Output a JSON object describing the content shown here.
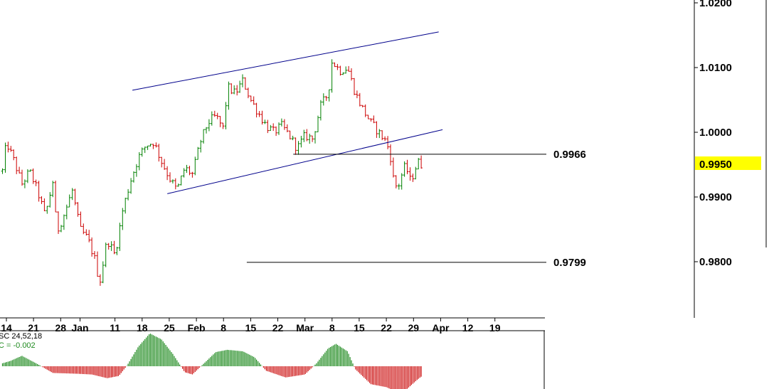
{
  "chart_data": {
    "type": "candlestick",
    "instrument": "",
    "ylim": [
      0.9755,
      1.0205
    ],
    "y_ticks": [
      {
        "value": 1.02,
        "label": "1.0200"
      },
      {
        "value": 1.01,
        "label": "1.0100"
      },
      {
        "value": 1.0,
        "label": "1.0000"
      },
      {
        "value": 0.99,
        "label": "0.9900"
      },
      {
        "value": 0.98,
        "label": "0.9800"
      }
    ],
    "x_ticks": [
      {
        "day": 0,
        "label": "14"
      },
      {
        "day": 7,
        "label": "21"
      },
      {
        "day": 14,
        "label": "28"
      },
      {
        "day": 19,
        "label": "Jan"
      },
      {
        "day": 28,
        "label": "11"
      },
      {
        "day": 35,
        "label": "18"
      },
      {
        "day": 42,
        "label": "25"
      },
      {
        "day": 49,
        "label": "Feb"
      },
      {
        "day": 56,
        "label": "8"
      },
      {
        "day": 63,
        "label": "15"
      },
      {
        "day": 70,
        "label": "22"
      },
      {
        "day": 77,
        "label": "Mar"
      },
      {
        "day": 84,
        "label": "8"
      },
      {
        "day": 91,
        "label": "15"
      },
      {
        "day": 98,
        "label": "22"
      },
      {
        "day": 105,
        "label": "29"
      },
      {
        "day": 112,
        "label": "Apr"
      },
      {
        "day": 119,
        "label": "12"
      },
      {
        "day": 126,
        "label": "19"
      }
    ],
    "anchors": [
      {
        "day": -1,
        "price": 0.994
      },
      {
        "day": 0,
        "price": 0.9985
      },
      {
        "day": 2,
        "price": 0.9955
      },
      {
        "day": 4,
        "price": 0.992
      },
      {
        "day": 6,
        "price": 0.994
      },
      {
        "day": 8,
        "price": 0.991
      },
      {
        "day": 10,
        "price": 0.987
      },
      {
        "day": 12,
        "price": 0.9925
      },
      {
        "day": 13,
        "price": 0.9845
      },
      {
        "day": 15,
        "price": 0.9875
      },
      {
        "day": 17,
        "price": 0.991
      },
      {
        "day": 19,
        "price": 0.985
      },
      {
        "day": 21,
        "price": 0.9835
      },
      {
        "day": 23,
        "price": 0.98
      },
      {
        "day": 24,
        "price": 0.9765
      },
      {
        "day": 26,
        "price": 0.9835
      },
      {
        "day": 28,
        "price": 0.981
      },
      {
        "day": 30,
        "price": 0.988
      },
      {
        "day": 32,
        "price": 0.9925
      },
      {
        "day": 34,
        "price": 0.996
      },
      {
        "day": 36,
        "price": 0.998
      },
      {
        "day": 38,
        "price": 0.9985
      },
      {
        "day": 40,
        "price": 0.9955
      },
      {
        "day": 42,
        "price": 0.993
      },
      {
        "day": 44,
        "price": 0.991
      },
      {
        "day": 46,
        "price": 0.9945
      },
      {
        "day": 48,
        "price": 0.9935
      },
      {
        "day": 50,
        "price": 0.9985
      },
      {
        "day": 52,
        "price": 1.0015
      },
      {
        "day": 54,
        "price": 1.0025
      },
      {
        "day": 56,
        "price": 1.0005
      },
      {
        "day": 57,
        "price": 1.007
      },
      {
        "day": 59,
        "price": 1.006
      },
      {
        "day": 61,
        "price": 1.008
      },
      {
        "day": 63,
        "price": 1.005
      },
      {
        "day": 65,
        "price": 1.003
      },
      {
        "day": 67,
        "price": 1.001
      },
      {
        "day": 69,
        "price": 1.0
      },
      {
        "day": 71,
        "price": 1.001
      },
      {
        "day": 73,
        "price": 0.9995
      },
      {
        "day": 75,
        "price": 0.9975
      },
      {
        "day": 77,
        "price": 0.9995
      },
      {
        "day": 79,
        "price": 0.999
      },
      {
        "day": 81,
        "price": 1.004
      },
      {
        "day": 83,
        "price": 1.006
      },
      {
        "day": 84,
        "price": 1.011
      },
      {
        "day": 86,
        "price": 1.0095
      },
      {
        "day": 88,
        "price": 1.01
      },
      {
        "day": 90,
        "price": 1.006
      },
      {
        "day": 92,
        "price": 1.0035
      },
      {
        "day": 94,
        "price": 1.0015
      },
      {
        "day": 96,
        "price": 1.0
      },
      {
        "day": 98,
        "price": 0.9985
      },
      {
        "day": 99,
        "price": 0.9965
      },
      {
        "day": 100,
        "price": 0.992
      },
      {
        "day": 101,
        "price": 0.9915
      },
      {
        "day": 102,
        "price": 0.9935
      },
      {
        "day": 103,
        "price": 0.995
      },
      {
        "day": 104,
        "price": 0.9925
      },
      {
        "day": 105,
        "price": 0.9935
      },
      {
        "day": 106,
        "price": 0.9955
      },
      {
        "day": 107,
        "price": 0.995
      }
    ],
    "channel_upper": {
      "start": {
        "day": 32.5,
        "price": 1.0065
      },
      "end": {
        "day": 111.5,
        "price": 1.0155
      }
    },
    "channel_lower": {
      "start": {
        "day": 41.5,
        "price": 0.9905
      },
      "end": {
        "day": 112.5,
        "price": 1.0004
      }
    },
    "levels": [
      {
        "value": 0.9966,
        "label": "0.9966",
        "from_day": 74
      },
      {
        "value": 0.9799,
        "label": "0.9799",
        "from_day": 62
      }
    ],
    "last_price": {
      "value": 0.995,
      "label": "0.9950",
      "highlight": "#ffff00"
    },
    "colors": {
      "up": "#008000",
      "down": "#cc0000",
      "trendline": "#00008b",
      "level": "#000000"
    },
    "indicator": {
      "name": "SC 24,52,18",
      "value_label": "C = -0.002",
      "colors": {
        "positive": "#1f8a1f",
        "negative": "#cc1111"
      },
      "anchors": [
        {
          "day": -1,
          "value": 0.2
        },
        {
          "day": 1,
          "value": 0.35
        },
        {
          "day": 4,
          "value": 0.7
        },
        {
          "day": 8,
          "value": 0.15
        },
        {
          "day": 12,
          "value": -0.45
        },
        {
          "day": 18,
          "value": -0.5
        },
        {
          "day": 22,
          "value": -0.55
        },
        {
          "day": 26,
          "value": -0.8
        },
        {
          "day": 29,
          "value": -0.65
        },
        {
          "day": 31,
          "value": 0.0
        },
        {
          "day": 34,
          "value": 1.3
        },
        {
          "day": 37,
          "value": 2.2
        },
        {
          "day": 40,
          "value": 1.8
        },
        {
          "day": 43,
          "value": 0.8
        },
        {
          "day": 46,
          "value": -0.4
        },
        {
          "day": 48,
          "value": -0.55
        },
        {
          "day": 51,
          "value": 0.2
        },
        {
          "day": 54,
          "value": 0.95
        },
        {
          "day": 57,
          "value": 1.1
        },
        {
          "day": 61,
          "value": 1.0
        },
        {
          "day": 64,
          "value": 0.6
        },
        {
          "day": 67,
          "value": -0.3
        },
        {
          "day": 72,
          "value": -0.75
        },
        {
          "day": 77,
          "value": -0.55
        },
        {
          "day": 80,
          "value": 0.2
        },
        {
          "day": 83,
          "value": 1.2
        },
        {
          "day": 85,
          "value": 1.5
        },
        {
          "day": 88,
          "value": 1.0
        },
        {
          "day": 90,
          "value": -0.2
        },
        {
          "day": 94,
          "value": -1.2
        },
        {
          "day": 98,
          "value": -1.4
        },
        {
          "day": 101,
          "value": -1.75
        },
        {
          "day": 103,
          "value": -1.6
        },
        {
          "day": 106,
          "value": -0.9
        },
        {
          "day": 107,
          "value": -0.7
        }
      ]
    }
  }
}
